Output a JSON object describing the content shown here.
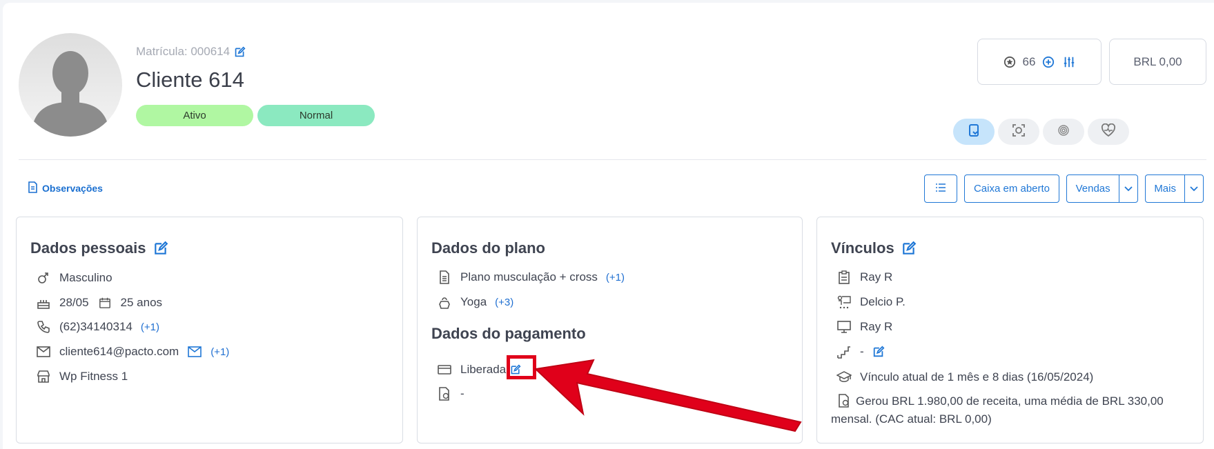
{
  "header": {
    "matricula_label": "Matrícula: 000614",
    "client_name": "Cliente 614",
    "status_badges": [
      "Ativo",
      "Normal"
    ],
    "points": "66",
    "balance": "BRL 0,00"
  },
  "toolbar": {
    "observacoes": "Observações",
    "caixa": "Caixa em aberto",
    "vendas": "Vendas",
    "mais": "Mais"
  },
  "personal": {
    "title": "Dados pessoais",
    "gender": "Masculino",
    "birthday": "28/05",
    "age": "25 anos",
    "phone": "(62)34140314",
    "phone_more": "(+1)",
    "email": "cliente614@pacto.com",
    "email_more": "(+1)",
    "unit": "Wp Fitness 1"
  },
  "plan": {
    "title": "Dados do plano",
    "plan_name": "Plano musculação + cross",
    "plan_more": "(+1)",
    "modality": "Yoga",
    "modality_more": "(+3)"
  },
  "payment": {
    "title": "Dados do pagamento",
    "status": "Liberada",
    "value": "-"
  },
  "links": {
    "title": "Vínculos",
    "consultant": "Ray R",
    "teacher": "Delcio P.",
    "manager": "Ray R",
    "level": "-",
    "current": "Vínculo atual de 1 mês e 8 dias (16/05/2024)",
    "revenue": "Gerou BRL 1.980,00 de receita, uma média de BRL 330,00 mensal. (CAC atual: BRL 0,00)"
  },
  "colors": {
    "accent": "#1f77d6",
    "ativo_badge": "#b0f7a2",
    "normal_badge": "#8be9c0",
    "annotation_red": "#e0001a"
  },
  "icons": {
    "edit": "edit-icon",
    "gender": "gender-icon",
    "cake": "cake-icon",
    "calendar": "calendar-icon",
    "phone": "phone-icon",
    "mail": "mail-icon",
    "store": "store-icon",
    "document": "document-icon",
    "kettlebell": "kettlebell-icon",
    "card": "credit-card-icon",
    "receipt": "receipt-money-icon",
    "clipboard": "clipboard-icon",
    "teacher": "teacher-icon",
    "monitor": "monitor-icon",
    "stairs": "stairs-icon",
    "graduation": "graduation-cap-icon",
    "list": "list-icon",
    "mobile": "mobile-icon",
    "face": "face-scan-icon",
    "fingerprint": "fingerprint-icon",
    "heart": "heart-pulse-icon"
  }
}
